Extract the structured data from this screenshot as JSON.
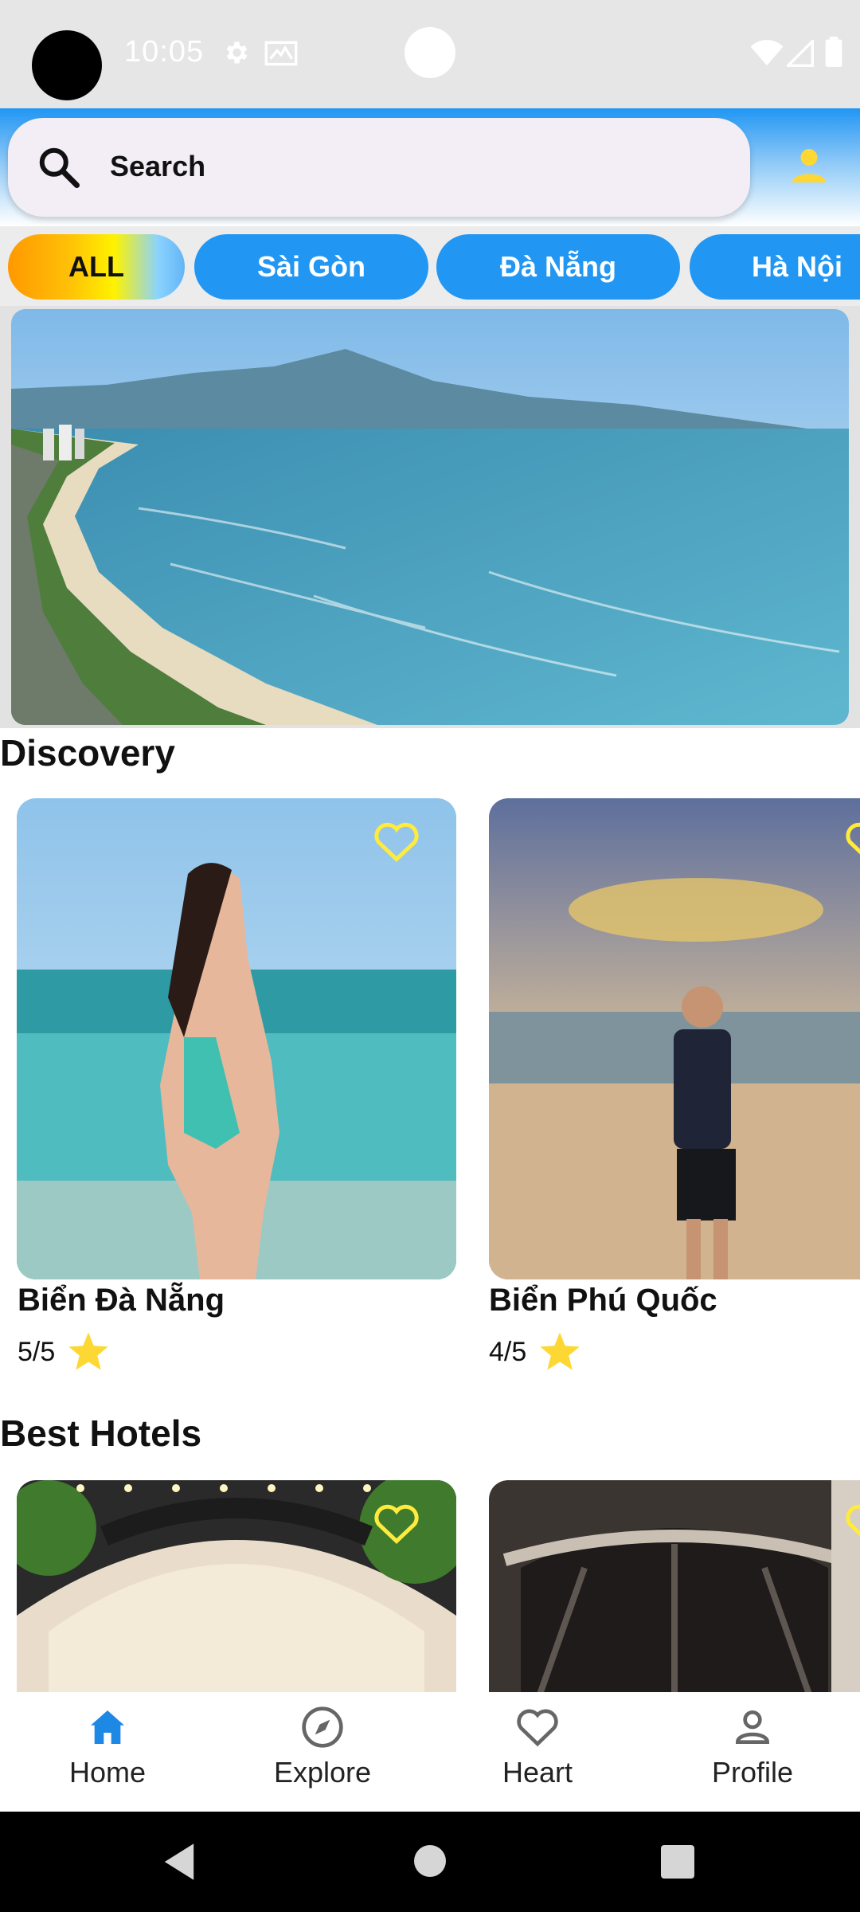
{
  "status_bar": {
    "time": "10:05",
    "icons": [
      "gear-icon",
      "mail-icon",
      "wifi-icon",
      "signal-icon",
      "battery-icon"
    ]
  },
  "search": {
    "label": "Search",
    "icon": "search-icon"
  },
  "header": {
    "account_icon": "account-icon"
  },
  "chips": [
    {
      "label": "ALL",
      "selected": true
    },
    {
      "label": "Sài Gòn",
      "selected": false
    },
    {
      "label": "Đà Nẵng",
      "selected": false
    },
    {
      "label": "Hà Nội",
      "selected": false
    }
  ],
  "sections": {
    "discovery": {
      "title": "Discovery",
      "cards": [
        {
          "name": "Biển Đà Nẵng",
          "rating": "5/5"
        },
        {
          "name": "Biển Phú Quốc",
          "rating": "4/5"
        }
      ]
    },
    "hotels": {
      "title": "Best Hotels"
    }
  },
  "bottom_nav": [
    {
      "label": "Home",
      "icon": "home-icon",
      "active": true
    },
    {
      "label": "Explore",
      "icon": "compass-icon",
      "active": false
    },
    {
      "label": "Heart",
      "icon": "heart-icon",
      "active": false
    },
    {
      "label": "Profile",
      "icon": "person-icon",
      "active": false
    }
  ],
  "colors": {
    "accent": "#2196f3",
    "favorite": "#ffeb3b",
    "star": "#fdd835"
  }
}
